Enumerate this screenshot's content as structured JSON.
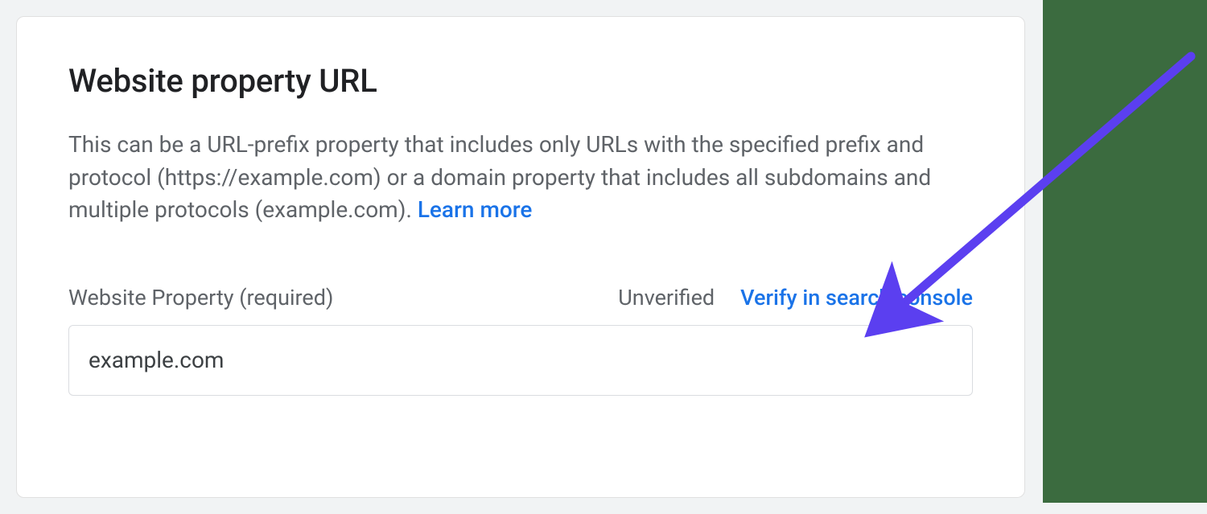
{
  "card": {
    "heading": "Website property URL",
    "description_prefix": "This can be a URL-prefix property that includes only URLs with the specified prefix and protocol (https://example.com) or a domain property that includes all subdomains and multiple protocols (example.com). ",
    "learn_more_label": "Learn more",
    "field": {
      "label": "Website Property (required)",
      "status": "Unverified",
      "verify_link_label": "Verify in search console",
      "value": "example.com"
    }
  },
  "annotation": {
    "arrow_color": "#5b3ff0"
  }
}
